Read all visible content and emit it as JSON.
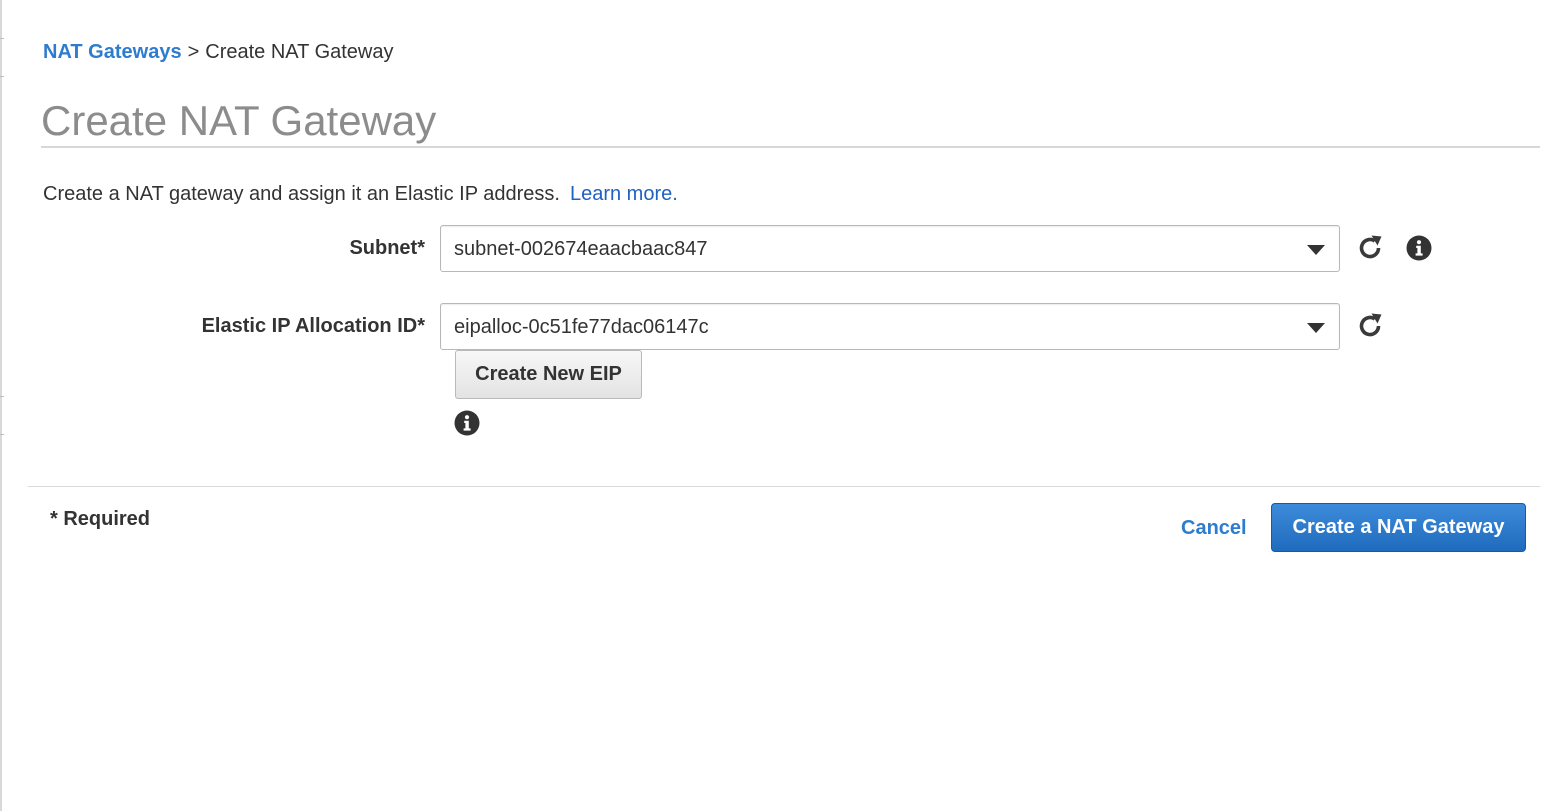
{
  "breadcrumb": {
    "parent": "NAT Gateways",
    "separator": ">",
    "current": "Create NAT Gateway"
  },
  "page": {
    "title": "Create NAT Gateway",
    "intro": "Create a NAT gateway and assign it an Elastic IP address.",
    "learn_more": "Learn more."
  },
  "form": {
    "subnet": {
      "label": "Subnet*",
      "value": "subnet-002674eaacbaac847"
    },
    "eip": {
      "label": "Elastic IP Allocation ID*",
      "value": "eipalloc-0c51fe77dac06147c",
      "create_button": "Create New EIP"
    }
  },
  "footer": {
    "required_note": "* Required",
    "cancel": "Cancel",
    "submit": "Create a NAT Gateway"
  },
  "icons": {
    "refresh": "refresh-icon",
    "info": "info-icon",
    "dropdown": "chevron-down-icon"
  },
  "colors": {
    "link": "#2e7ccf",
    "primary": "#2770c6",
    "title": "#8c8c8c"
  }
}
